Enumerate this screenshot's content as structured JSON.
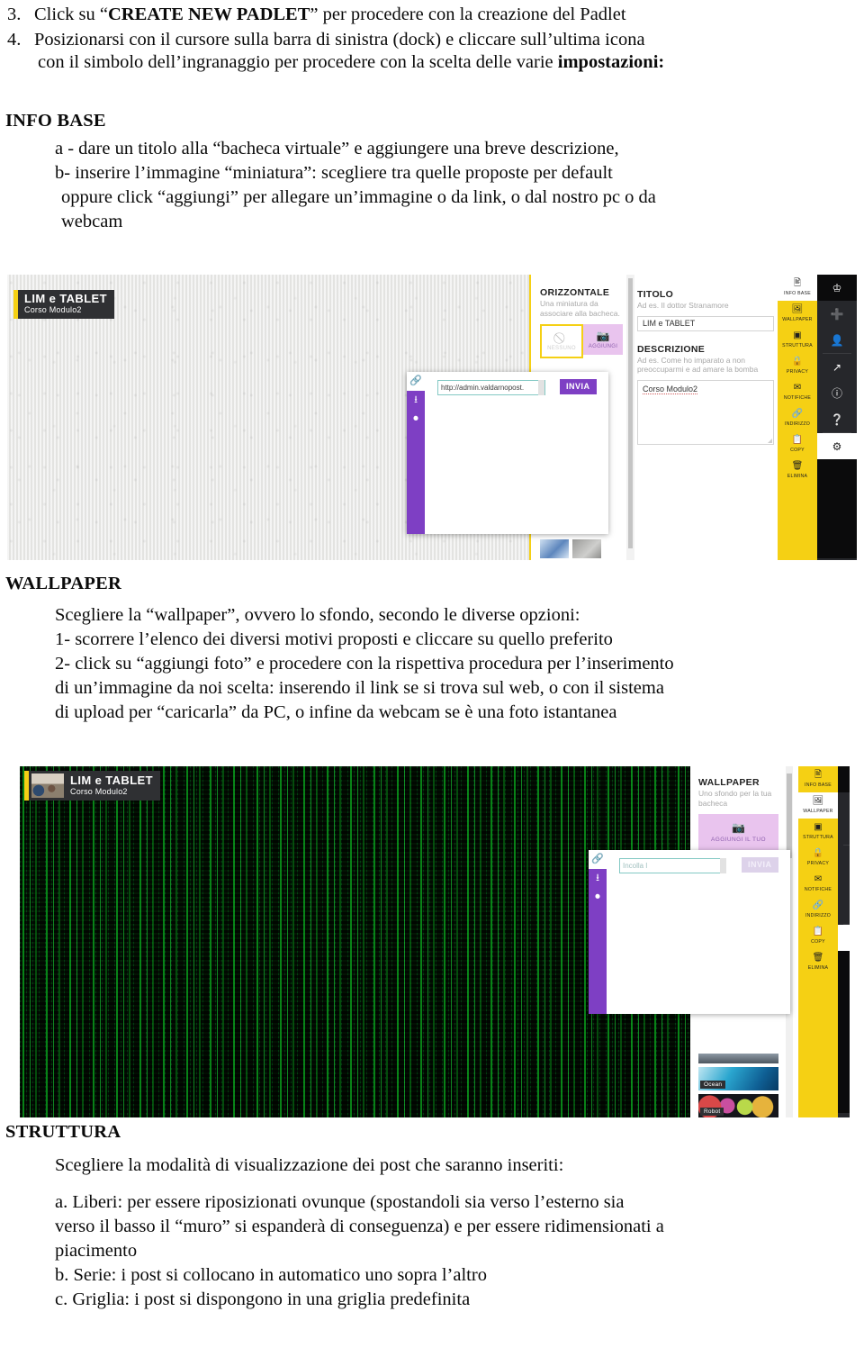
{
  "steps": [
    {
      "num": "3.",
      "pre": "Click su “",
      "bold": "CREATE NEW PADLET",
      "post": "” per procedere con la creazione del Padlet"
    },
    {
      "num": "4.",
      "pre": "Posizionarsi con il cursore sulla barra di sinistra (dock) e cliccare sull’ultima icona",
      "bold": "",
      "post": ""
    }
  ],
  "step4_cont_pre": "con il simbolo dell’ingranaggio per procedere con la scelta delle varie ",
  "step4_cont_bold": "impostazioni:",
  "sections": {
    "info_base": {
      "heading": "INFO BASE",
      "lines": [
        "a - dare un titolo alla  “bacheca virtuale” e aggiungere una breve descrizione,",
        "b- inserire l’immagine “miniatura”: scegliere tra quelle proposte per default",
        "oppure click “aggiungi” per allegare un’immagine o da  link, o dal nostro pc o da",
        "webcam"
      ]
    },
    "wallpaper": {
      "heading": "WALLPAPER",
      "lines": [
        "Scegliere  la “wallpaper”, ovvero lo sfondo, secondo le diverse opzioni:",
        "1-  scorrere l’elenco dei diversi motivi proposti e cliccare su quello preferito",
        "2- click su “aggiungi foto” e procedere con la rispettiva procedura per l’inserimento",
        "di un’immagine da noi scelta:  inserendo il link se si trova sul web, o con il sistema",
        "di upload per  “caricarla” da PC, o infine da webcam se è una foto istantanea"
      ]
    },
    "struttura": {
      "heading": "STRUTTURA",
      "intro": "Scegliere la modalità di visualizzazione dei post che saranno inseriti:",
      "lines": [
        "a. Liberi: per essere riposizionati ovunque (spostandoli sia verso l’esterno sia",
        "verso il basso il “muro” si espanderà di conseguenza) e per essere ridimensionati a",
        "piacimento",
        "b. Serie: i post si collocano in automatico uno sopra l’altro",
        "c. Griglia: i post si dispongono in una griglia predefinita"
      ]
    }
  },
  "screenshot1": {
    "logo": {
      "title": "LIM e TABLET",
      "subtitle": "Corso Modulo2"
    },
    "thumb_panel": {
      "heading": "ORIZZONTALE",
      "subtitle": "Una miniatura da associare alla bacheca.",
      "option_none": "NESSUNO",
      "option_add": "AGGIUNGI"
    },
    "link_popover": {
      "url_value": "http://admin.valdarnopost.",
      "send_label": "INVIA",
      "rail_icons": [
        "link-icon",
        "upload-icon",
        "webcam-icon"
      ]
    },
    "settings": {
      "titolo_label": "TITOLO",
      "titolo_hint": "Ad es. Il dottor Stranamore",
      "titolo_value": "LIM e TABLET",
      "descrizione_label": "DESCRIZIONE",
      "descrizione_hint": "Ad es. Come ho imparato a non preoccuparmi e ad amare la bomba",
      "descrizione_value": "Corso Modulo2"
    },
    "yellow_rail": [
      {
        "label": "INFO BASE",
        "icon": "info-card-icon",
        "active": true
      },
      {
        "label": "WALLPAPER",
        "icon": "image-icon",
        "active": false
      },
      {
        "label": "STRUTTURA",
        "icon": "layout-icon",
        "active": false
      },
      {
        "label": "PRIVACY",
        "icon": "lock-icon",
        "active": false
      },
      {
        "label": "NOTIFICHE",
        "icon": "bell-icon",
        "active": false
      },
      {
        "label": "INDIRIZZO",
        "icon": "link-icon",
        "active": false
      },
      {
        "label": "COPY",
        "icon": "copy-icon",
        "active": false
      },
      {
        "label": "ELIMINA",
        "icon": "trash-icon",
        "active": false
      }
    ],
    "dock": [
      {
        "icon": "crown-icon",
        "style": "black"
      },
      {
        "icon": "plus-icon",
        "style": "dark"
      },
      {
        "icon": "person-icon",
        "style": "dark"
      },
      {
        "icon": "share-icon",
        "style": "dark"
      },
      {
        "icon": "info-icon",
        "style": "dark"
      },
      {
        "icon": "help-icon",
        "style": "dark"
      },
      {
        "icon": "gear-icon",
        "style": "white"
      }
    ]
  },
  "screenshot2": {
    "logo": {
      "title": "LIM e TABLET",
      "subtitle": "Corso Modulo2"
    },
    "wallpaper_panel": {
      "heading": "WALLPAPER",
      "subtitle": "Uno sfondo per la tua bacheca",
      "add_label": "AGGIUNGI IL TUO",
      "thumbs": [
        {
          "caption": ""
        },
        {
          "caption": "Ocean"
        },
        {
          "caption": "Robot"
        }
      ]
    },
    "link_popover": {
      "url_placeholder": "Incolla l",
      "send_label": "INVIA",
      "rail_icons": [
        "link-icon",
        "upload-icon",
        "webcam-icon"
      ]
    },
    "yellow_rail": [
      {
        "label": "INFO BASE",
        "icon": "info-card-icon",
        "active": false
      },
      {
        "label": "WALLPAPER",
        "icon": "image-icon",
        "active": true
      },
      {
        "label": "STRUTTURA",
        "icon": "layout-icon",
        "active": false
      },
      {
        "label": "PRIVACY",
        "icon": "lock-icon",
        "active": false
      },
      {
        "label": "NOTIFICHE",
        "icon": "bell-icon",
        "active": false
      },
      {
        "label": "INDIRIZZO",
        "icon": "link-icon",
        "active": false
      },
      {
        "label": "COPY",
        "icon": "copy-icon",
        "active": false
      },
      {
        "label": "ELIMINA",
        "icon": "trash-icon",
        "active": false
      }
    ],
    "dock": [
      {
        "icon": "crown-icon",
        "style": "black"
      },
      {
        "icon": "plus-icon",
        "style": "dark"
      },
      {
        "icon": "person-icon",
        "style": "dark"
      },
      {
        "icon": "share-icon",
        "style": "dark"
      },
      {
        "icon": "info-icon",
        "style": "dark"
      },
      {
        "icon": "help-icon",
        "style": "dark"
      },
      {
        "icon": "gear-icon",
        "style": "white"
      }
    ]
  },
  "colors": {
    "padlet_yellow": "#f5d014",
    "padlet_purple": "#7e3fc4",
    "pink_panel": "#e9c4ee",
    "dock_dark": "#26272b",
    "matrix_green": "#12d012"
  }
}
